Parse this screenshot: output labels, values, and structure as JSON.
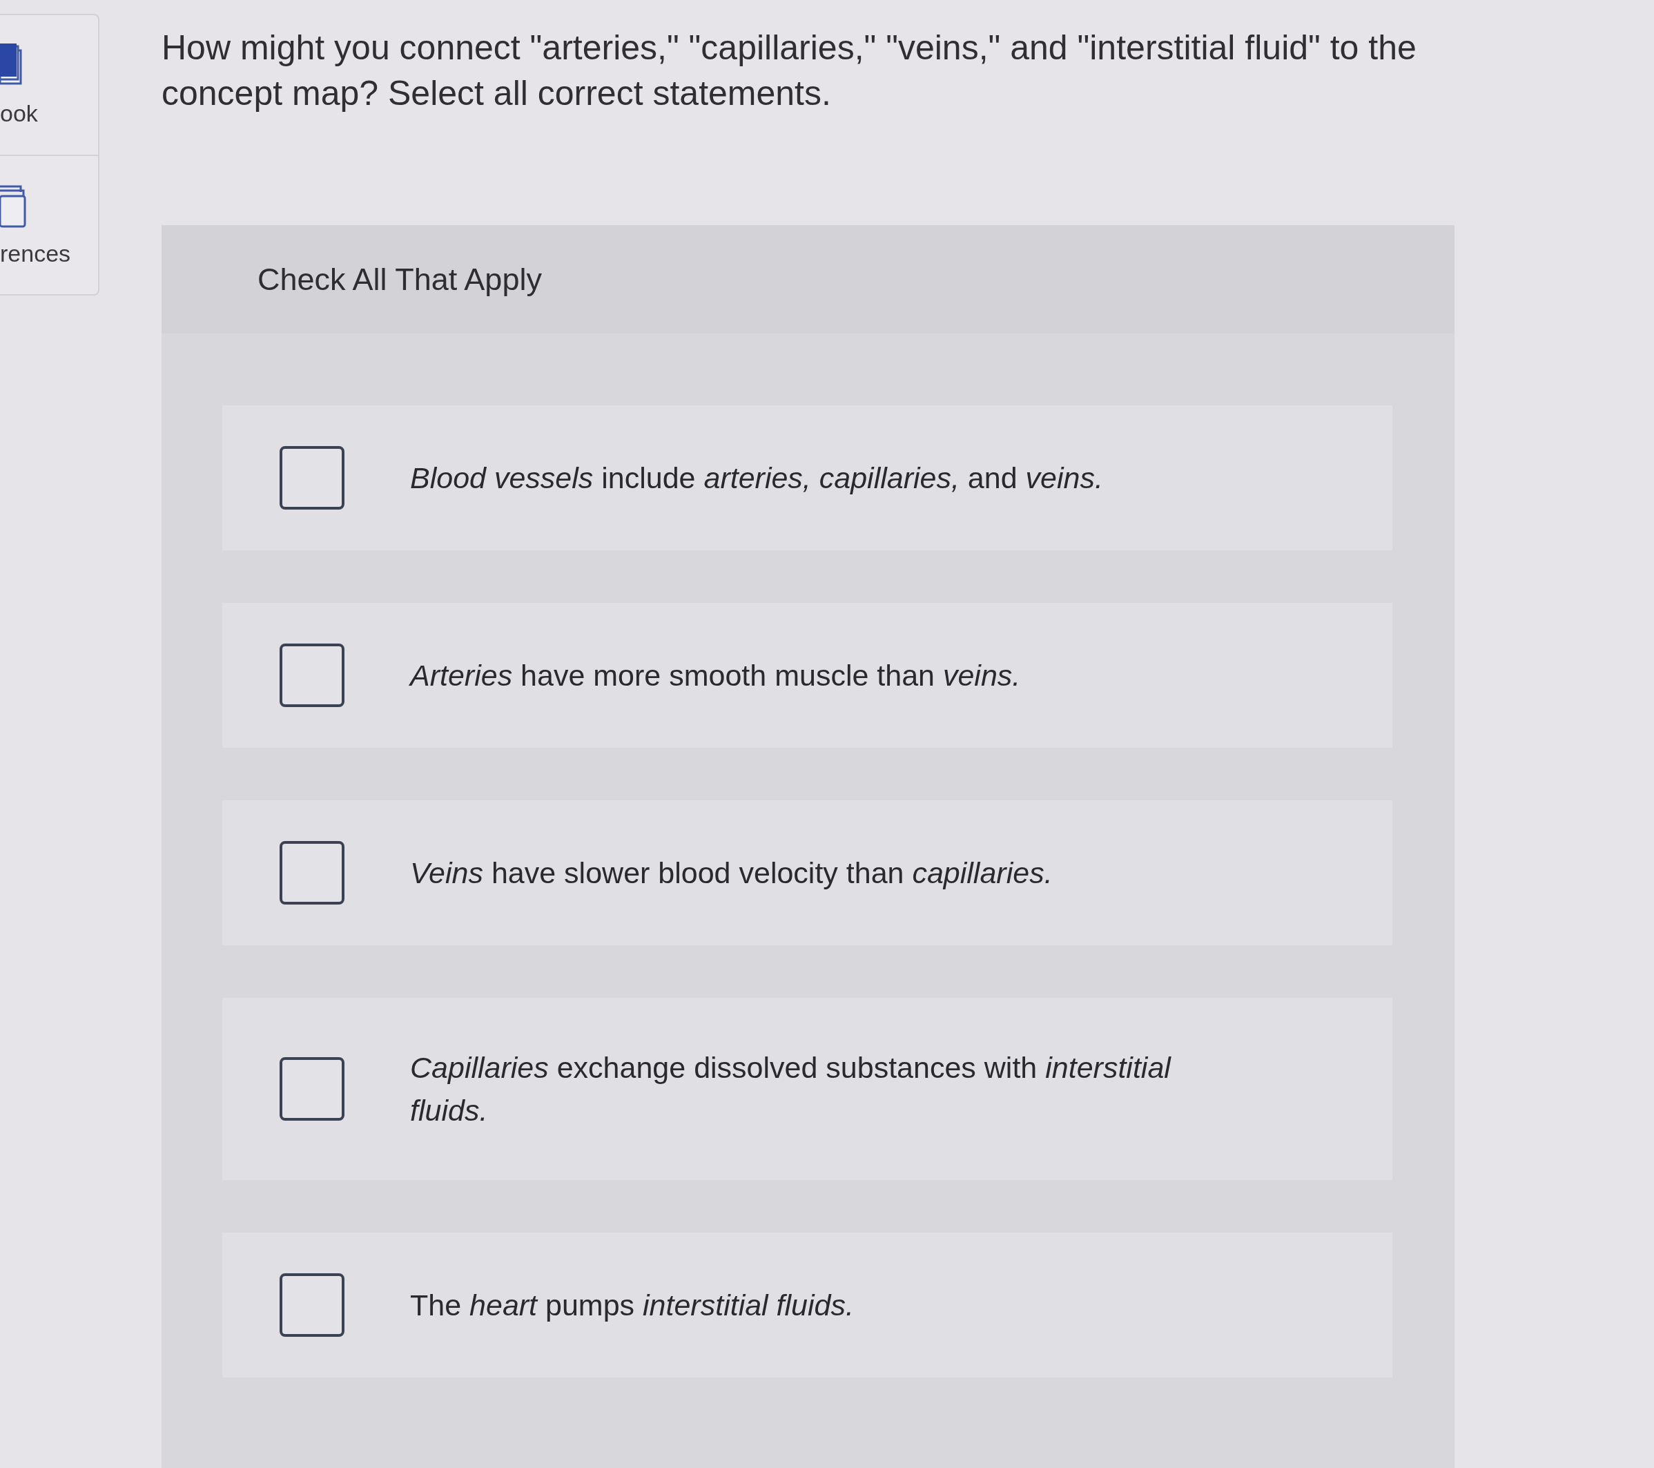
{
  "sidebar": {
    "items": [
      {
        "kind": "book",
        "label": "ook"
      },
      {
        "kind": "references",
        "label": "rences"
      }
    ]
  },
  "question": "How might you connect \"arteries,\" \"capillaries,\" \"veins,\" and \"interstitial fluid\" to the concept map? Select all correct statements.",
  "panel": {
    "heading": "Check All That Apply",
    "options": [
      {
        "text": "*Blood vessels* include *arteries, capillaries,* and *veins.*",
        "checked": false
      },
      {
        "text": "*Arteries* have more smooth muscle than *veins.*",
        "checked": false
      },
      {
        "text": "*Veins* have slower blood velocity than *capillaries.*",
        "checked": false
      },
      {
        "text": "*Capillaries* exchange dissolved substances with *interstitial fluids.*",
        "checked": false
      },
      {
        "text": "The *heart* pumps *interstitial fluids.*",
        "checked": false
      }
    ]
  }
}
